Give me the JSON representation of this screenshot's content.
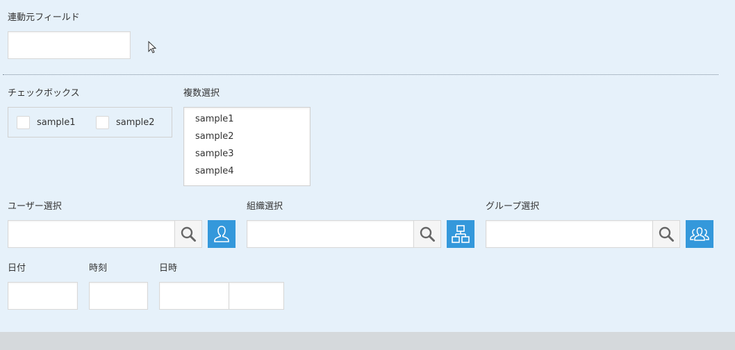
{
  "source_field": {
    "label": "連動元フィールド",
    "value": ""
  },
  "checkbox": {
    "label": "チェックボックス",
    "options": [
      "sample1",
      "sample2"
    ]
  },
  "multi_select": {
    "label": "複数選択",
    "options": [
      "sample1",
      "sample2",
      "sample3",
      "sample4"
    ]
  },
  "user_select": {
    "label": "ユーザー選択",
    "value": ""
  },
  "org_select": {
    "label": "組織選択",
    "value": ""
  },
  "group_select": {
    "label": "グループ選択",
    "value": ""
  },
  "date": {
    "label": "日付",
    "value": ""
  },
  "time": {
    "label": "時刻",
    "value": ""
  },
  "datetime": {
    "label": "日時",
    "date_value": "",
    "time_value": ""
  },
  "colors": {
    "background": "#e6f1fa",
    "accent": "#3498db",
    "footer": "#d5d9dc"
  },
  "icons": {
    "search": "search-icon",
    "user": "user-icon",
    "org": "org-chart-icon",
    "group": "group-icon",
    "cursor": "mouse-cursor-icon"
  }
}
